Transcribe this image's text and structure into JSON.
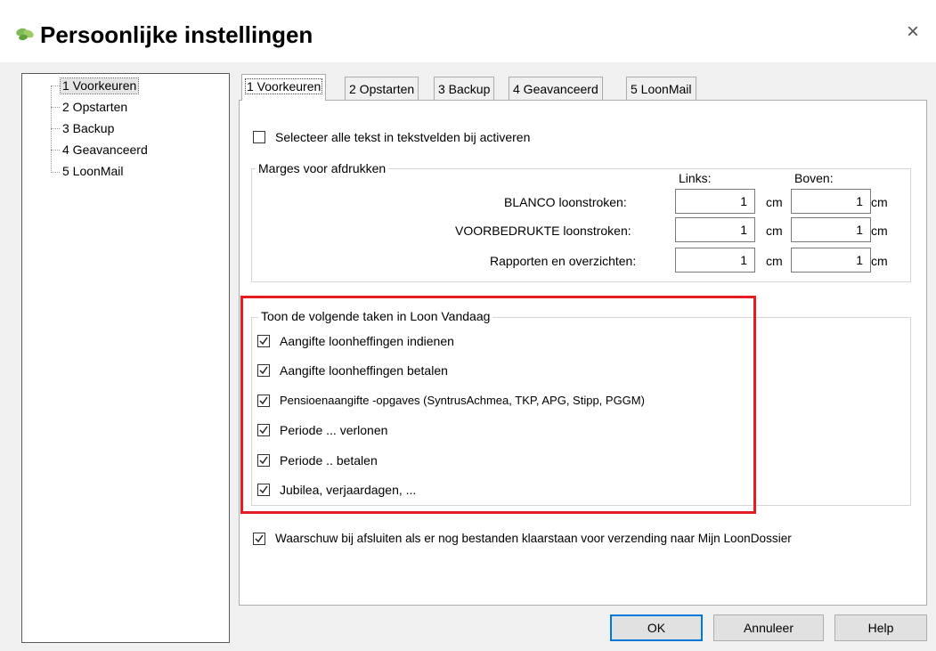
{
  "window": {
    "title": "Persoonlijke instellingen",
    "close_glyph": "×",
    "app_icon": "leaf-icon",
    "accent": "#0078d7"
  },
  "tree": {
    "items": [
      {
        "label": "1 Voorkeuren",
        "selected": true
      },
      {
        "label": "2 Opstarten"
      },
      {
        "label": "3 Backup"
      },
      {
        "label": "4 Geavanceerd"
      },
      {
        "label": "5 LoonMail"
      }
    ]
  },
  "tabs": [
    {
      "label": "1 Voorkeuren",
      "active": true
    },
    {
      "label": "2 Opstarten"
    },
    {
      "label": "3 Backup"
    },
    {
      "label": "4 Geavanceerd"
    },
    {
      "label": "5 LoonMail"
    }
  ],
  "select_all": {
    "label": "Selecteer alle tekst in tekstvelden bij activeren",
    "checked": false
  },
  "margins": {
    "legend": "Marges voor afdrukken",
    "col_left": "Links:",
    "col_top": "Boven:",
    "unit": "cm",
    "rows": [
      {
        "label": "BLANCO loonstroken:",
        "left": "1",
        "top": "1"
      },
      {
        "label": "VOORBEDRUKTE loonstroken:",
        "left": "1",
        "top": "1"
      },
      {
        "label": "Rapporten en overzichten:",
        "left": "1",
        "top": "1"
      }
    ]
  },
  "tasks": {
    "legend": "Toon de volgende taken in Loon Vandaag",
    "highlight_color": "#e51c23",
    "items": [
      {
        "label": "Aangifte loonheffingen indienen",
        "checked": true
      },
      {
        "label": "Aangifte loonheffingen betalen",
        "checked": true
      },
      {
        "label": "Pensioenaangifte -opgaves (SyntrusAchmea, TKP, APG, Stipp, PGGM)",
        "checked": true
      },
      {
        "label": "Periode ... verlonen",
        "checked": true
      },
      {
        "label": "Periode .. betalen",
        "checked": true
      },
      {
        "label": "Jubilea, verjaardagen, ...",
        "checked": true
      }
    ]
  },
  "warn": {
    "label": "Waarschuw bij afsluiten als er nog bestanden klaarstaan voor verzending naar Mijn LoonDossier",
    "checked": true
  },
  "buttons": {
    "ok": "OK",
    "cancel": "Annuleer",
    "help": "Help"
  }
}
